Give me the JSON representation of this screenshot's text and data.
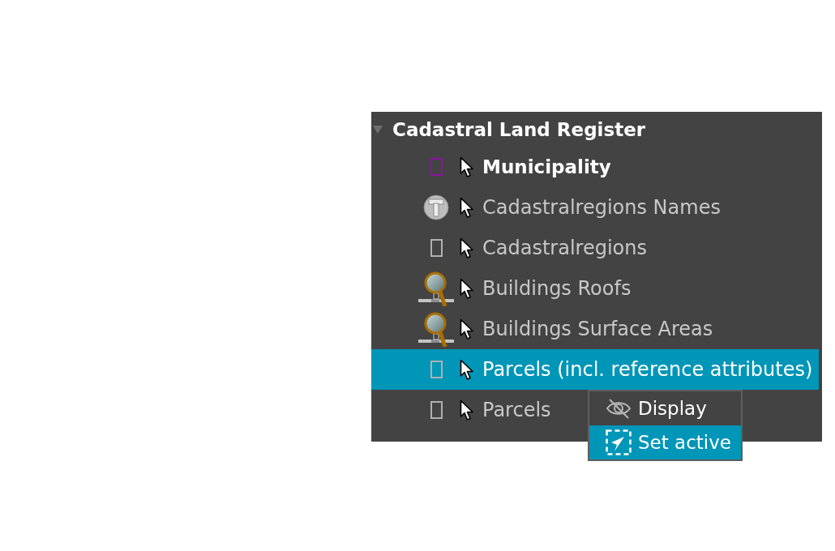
{
  "tree": {
    "label": "Cadastral Land Register",
    "expanded": true,
    "children": [
      {
        "label": "Municipality",
        "kind": "polygon",
        "color": "#8b12a3",
        "active": true,
        "selected": false
      },
      {
        "label": "Cadastralregions Names",
        "kind": "text",
        "active": false,
        "selected": false
      },
      {
        "label": "Cadastralregions",
        "kind": "polygon",
        "color": "#b0b0b0",
        "active": false,
        "selected": false
      },
      {
        "label": "Buildings Roofs",
        "kind": "magnifier",
        "active": false,
        "selected": false
      },
      {
        "label": "Buildings Surface Areas",
        "kind": "magnifier",
        "active": false,
        "selected": false
      },
      {
        "label": "Parcels (incl. reference attributes)",
        "kind": "polygon",
        "color": "#b0b0b0",
        "active": false,
        "selected": true
      },
      {
        "label": "Parcels",
        "kind": "polygon",
        "color": "#b0b0b0",
        "active": false,
        "selected": false
      }
    ]
  },
  "context_menu": {
    "items": [
      {
        "label": "Display",
        "kind": "hidden",
        "selected": false
      },
      {
        "label": "Set active",
        "kind": "activate",
        "selected": true
      }
    ]
  }
}
